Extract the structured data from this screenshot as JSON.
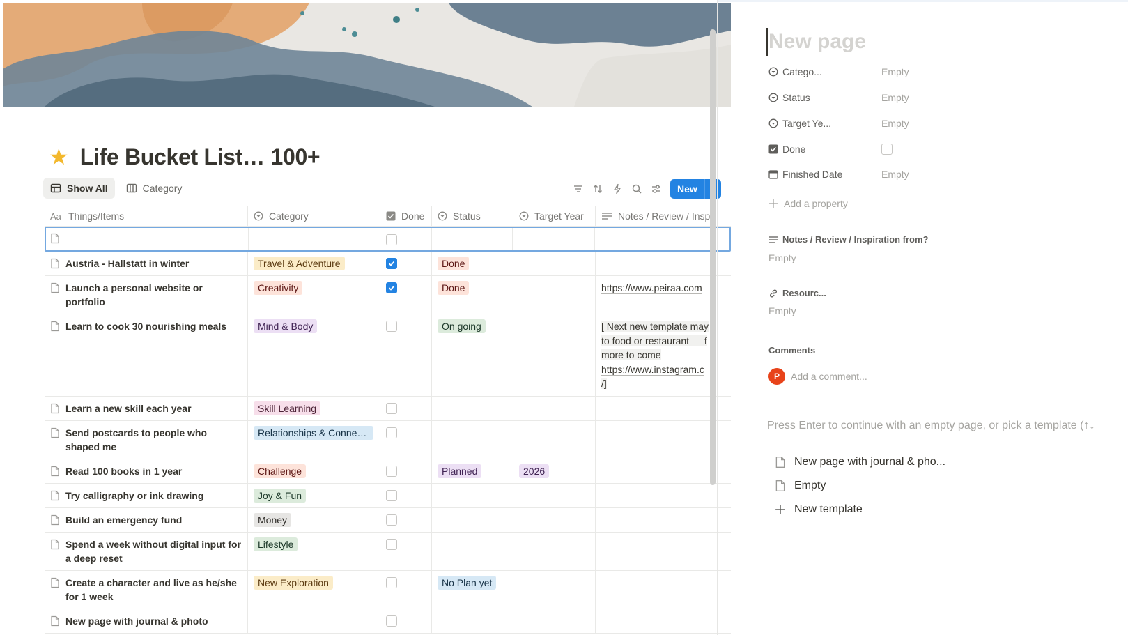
{
  "page": {
    "title": "Life Bucket List… 100+",
    "title_icon": "star-emoji"
  },
  "views": [
    {
      "label": "Show All",
      "icon": "table-icon",
      "active": true
    },
    {
      "label": "Category",
      "icon": "board-icon",
      "active": false
    }
  ],
  "toolbar": {
    "icons": [
      "filter-icon",
      "sort-icon",
      "automation-icon",
      "search-icon",
      "settings-icon"
    ],
    "new_label": "New"
  },
  "table": {
    "columns": [
      {
        "label": "Things/Items",
        "icon": "text-property-icon"
      },
      {
        "label": "Category",
        "icon": "select-property-icon"
      },
      {
        "label": "Done",
        "icon": "checkbox-property-icon"
      },
      {
        "label": "Status",
        "icon": "status-property-icon"
      },
      {
        "label": "Target Year",
        "icon": "select-property-icon"
      },
      {
        "label": "Notes / Review / Insp",
        "icon": "text-lines-icon"
      }
    ],
    "rows": [
      {
        "name": "Austria - Hallstatt in winter",
        "category": "Travel & Adventure",
        "done": true,
        "status": "Done",
        "target_year": "",
        "notes": []
      },
      {
        "name": "Launch a personal website or portfolio",
        "category": "Creativity",
        "done": true,
        "status": "Done",
        "target_year": "",
        "notes": [
          "https://www.peiraa.com"
        ]
      },
      {
        "name": "Learn to cook 30 nourishing meals",
        "category": "Mind & Body",
        "done": false,
        "status": "On going",
        "target_year": "",
        "notes": [
          "[ Next new template may",
          "to food or restaurant — f",
          "more to come",
          "https://www.instagram.c",
          "/]"
        ]
      },
      {
        "name": "Learn a new skill each year",
        "category": "Skill Learning",
        "done": false,
        "status": "",
        "target_year": "",
        "notes": []
      },
      {
        "name": "Send postcards to people who shaped me",
        "category": "Relationships & Connec...",
        "done": false,
        "status": "",
        "target_year": "",
        "notes": []
      },
      {
        "name": "Read 100 books in 1 year",
        "category": "Challenge",
        "done": false,
        "status": "Planned",
        "target_year": "2026",
        "notes": []
      },
      {
        "name": "Try calligraphy or ink drawing",
        "category": "Joy & Fun",
        "done": false,
        "status": "",
        "target_year": "",
        "notes": []
      },
      {
        "name": "Build an emergency fund",
        "category": "Money",
        "done": false,
        "status": "",
        "target_year": "",
        "notes": []
      },
      {
        "name": "Spend a week without digital input for a deep reset",
        "category": "Lifestyle",
        "done": false,
        "status": "",
        "target_year": "",
        "notes": []
      },
      {
        "name": "Create a character and live as he/she for 1 week",
        "category": "New Exploration",
        "done": false,
        "status": "No Plan yet",
        "target_year": "",
        "notes": []
      },
      {
        "name": "New page with journal & photo",
        "category": "",
        "done": false,
        "status": "",
        "target_year": "",
        "notes": []
      }
    ]
  },
  "colors": {
    "Travel & Adventure": {
      "bg": "#fbecc8",
      "fg": "#5c3b12"
    },
    "Creativity": {
      "bg": "#fde3da",
      "fg": "#5d1715"
    },
    "Mind & Body": {
      "bg": "#ecdff4",
      "fg": "#412454"
    },
    "Skill Learning": {
      "bg": "#f7deea",
      "fg": "#4c2337"
    },
    "Relationships & Connec...": {
      "bg": "#d6e8f5",
      "fg": "#183347"
    },
    "Challenge": {
      "bg": "#fde3da",
      "fg": "#5d1715"
    },
    "Joy & Fun": {
      "bg": "#dcebdc",
      "fg": "#1c3829"
    },
    "Money": {
      "bg": "#e6e5e3",
      "fg": "#32302c"
    },
    "Lifestyle": {
      "bg": "#dcebdc",
      "fg": "#1c3829"
    },
    "New Exploration": {
      "bg": "#fbecc8",
      "fg": "#5c3b12"
    },
    "Done": {
      "bg": "#fde3da",
      "fg": "#5d1715"
    },
    "On going": {
      "bg": "#dcebdc",
      "fg": "#1c3829"
    },
    "Planned": {
      "bg": "#ecdff4",
      "fg": "#412454"
    },
    "No Plan yet": {
      "bg": "#d6e8f5",
      "fg": "#183347"
    },
    "2026": {
      "bg": "#ecdff4",
      "fg": "#412454"
    }
  },
  "peek": {
    "title_placeholder": "New page",
    "properties": [
      {
        "label": "Catego...",
        "icon": "select-property-icon",
        "value": "Empty"
      },
      {
        "label": "Status",
        "icon": "status-property-icon",
        "value": "Empty"
      },
      {
        "label": "Target Ye...",
        "icon": "select-property-icon",
        "value": "Empty"
      },
      {
        "label": "Done",
        "icon": "checkbox-property-icon",
        "value": ""
      },
      {
        "label": "Finished Date",
        "icon": "calendar-icon",
        "value": "Empty"
      }
    ],
    "add_property": "Add a property",
    "notes_label": "Notes / Review / Inspiration from?",
    "notes_value": "Empty",
    "resource_label": "Resourc...",
    "resource_value": "Empty",
    "comments_label": "Comments",
    "avatar_letter": "P",
    "comment_placeholder": "Add a comment...",
    "hint": "Press Enter to continue with an empty page, or pick a template (↑↓",
    "templates": [
      {
        "label": "New page with journal & pho...",
        "icon": "page-icon"
      },
      {
        "label": "Empty",
        "icon": "page-icon"
      },
      {
        "label": "New template",
        "icon": "plus-icon"
      }
    ]
  }
}
